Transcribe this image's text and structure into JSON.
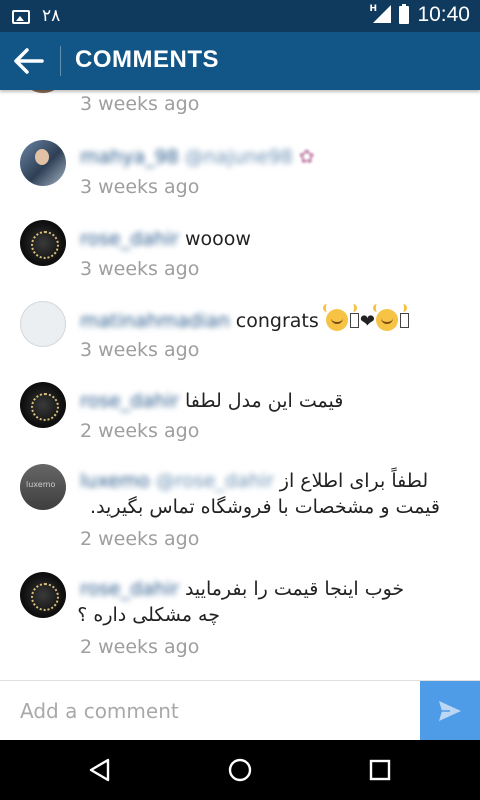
{
  "status_bar": {
    "notification_icon": "image-icon",
    "notification_count": "٢٨",
    "network_type": "H",
    "time": "10:40"
  },
  "app_bar": {
    "back_icon": "arrow-left-icon",
    "title": "COMMENTS"
  },
  "comments": [
    {
      "avatar": "avatar-brown",
      "username": "",
      "mention": "",
      "text": "",
      "time": "3 weeks ago"
    },
    {
      "avatar": "avatar-photo",
      "username": "mahya_98",
      "mention": "@najune98",
      "text": "",
      "time": "3 weeks ago"
    },
    {
      "avatar": "avatar-dark",
      "username": "rose_dahir",
      "mention": "",
      "text": "wooow",
      "time": "3 weeks ago"
    },
    {
      "avatar": "avatar-blank",
      "username": "matinahmadian",
      "mention": "",
      "text": "congrats",
      "time": "3 weeks ago"
    },
    {
      "avatar": "avatar-dark",
      "username": "rose_dahir",
      "mention": "",
      "text": "قیمت این مدل لطفا",
      "time": "2 weeks ago"
    },
    {
      "avatar": "avatar-grey",
      "username": "luxemo",
      "mention": "@rose_dahir",
      "text": "لطفاً برای اطلاع از",
      "text_line2": "قیمت و مشخصات با فروشگاه تماس بگیرید.",
      "time": "2 weeks ago"
    },
    {
      "avatar": "avatar-dark",
      "username": "rose_dahir",
      "mention": "",
      "text": "خوب اینجا قیمت را بفرمایید",
      "text_line2": "چه مشکلی داره ؟",
      "time": "2 weeks ago"
    }
  ],
  "add_comment": {
    "placeholder": "Add a comment",
    "value": "",
    "send_icon": "send-icon"
  },
  "nav_bar": {
    "back_icon": "nav-back-icon",
    "home_icon": "nav-home-icon",
    "recents_icon": "nav-recents-icon"
  }
}
